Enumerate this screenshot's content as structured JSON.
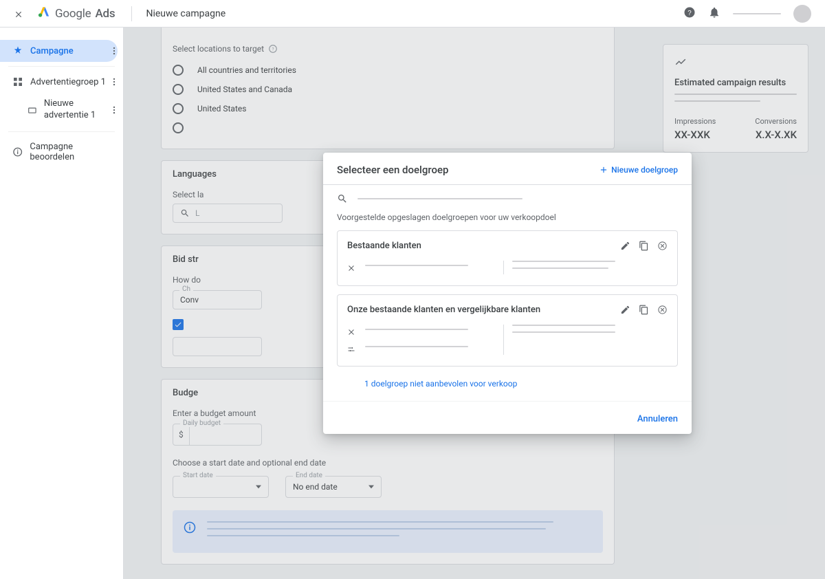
{
  "header": {
    "product_google": "Google",
    "product_ads": "Ads",
    "page_title": "Nieuwe campagne"
  },
  "sidebar": {
    "campaign": "Campagne",
    "adgroup": "Advertentiegroep 1",
    "new_ad": "Nieuwe advertentie 1",
    "review": "Campagne beoordelen"
  },
  "locations": {
    "title": "Select locations to target",
    "options": [
      "All countries and territories",
      "United States and Canada",
      "United States"
    ]
  },
  "languages": {
    "head": "Languages",
    "prompt": "Select la",
    "search": "L"
  },
  "bid": {
    "head": "Bid str",
    "question": "How do",
    "choose_label": "Ch",
    "choose_value": "Conv"
  },
  "budget": {
    "head": "Budge",
    "amount_label": "Enter a budget amount",
    "daily": "Daily budget",
    "currency": "$",
    "dates_label": "Choose a start date and optional end date",
    "start": "Start date",
    "end": "End date",
    "no_end": "No end date"
  },
  "estimate": {
    "title": "Estimated campaign results",
    "impressions_label": "Impressions",
    "impressions_value": "XX-XXK",
    "conversions_label": "Conversions",
    "conversions_value": "X.X-X.XK"
  },
  "modal": {
    "title": "Selecteer een doelgroep",
    "new_audience": "Nieuwe doelgroep",
    "suggested": "Voorgestelde opgeslagen doelgroepen voor uw verkoopdoel",
    "audiences": [
      {
        "title": "Bestaande klanten"
      },
      {
        "title": "Onze bestaande klanten en vergelijkbare klanten"
      }
    ],
    "not_recommended": "1 doelgroep niet aanbevolen voor verkoop",
    "cancel": "Annuleren"
  }
}
